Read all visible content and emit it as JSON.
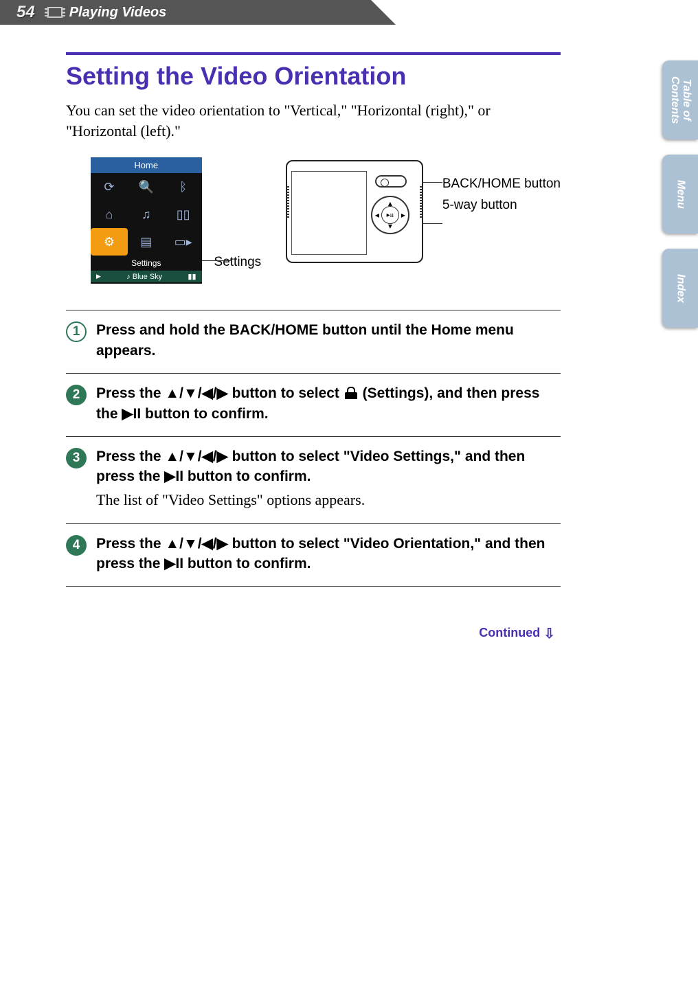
{
  "header": {
    "page_number": "54",
    "section": "Playing Videos"
  },
  "side_tabs": {
    "toc": "Table of\nContents",
    "menu": "Menu",
    "index": "Index"
  },
  "title": "Setting the Video Orientation",
  "intro": "You can set the video orientation to \"Vertical,\" \"Horizontal (right),\" or \"Horizontal (left).\"",
  "figures": {
    "home_menu": {
      "top_label": "Home",
      "settings_label": "Settings",
      "now_playing_prefix": "♪",
      "now_playing_text": "Blue Sky",
      "callout": "Settings"
    },
    "device": {
      "labels": {
        "back_home_button": "BACK/HOME button",
        "five_way_button": "5-way button"
      }
    }
  },
  "steps": [
    {
      "text": "Press and hold the BACK/HOME button until the Home menu appears."
    },
    {
      "pre": "Press the ▲/▼/◀/▶ button to select ",
      "post": " (Settings), and then press the ▶II button to confirm.",
      "has_icon": true
    },
    {
      "pre": "Press the ▲/▼/◀/▶ button to select \"Video Settings,\" and then press the ▶II button to confirm.",
      "note": "The list of \"Video Settings\" options appears."
    },
    {
      "pre": "Press the ▲/▼/◀/▶ button to select \"Video Orientation,\" and then press the ▶II button to confirm."
    }
  ],
  "continued": "Continued"
}
